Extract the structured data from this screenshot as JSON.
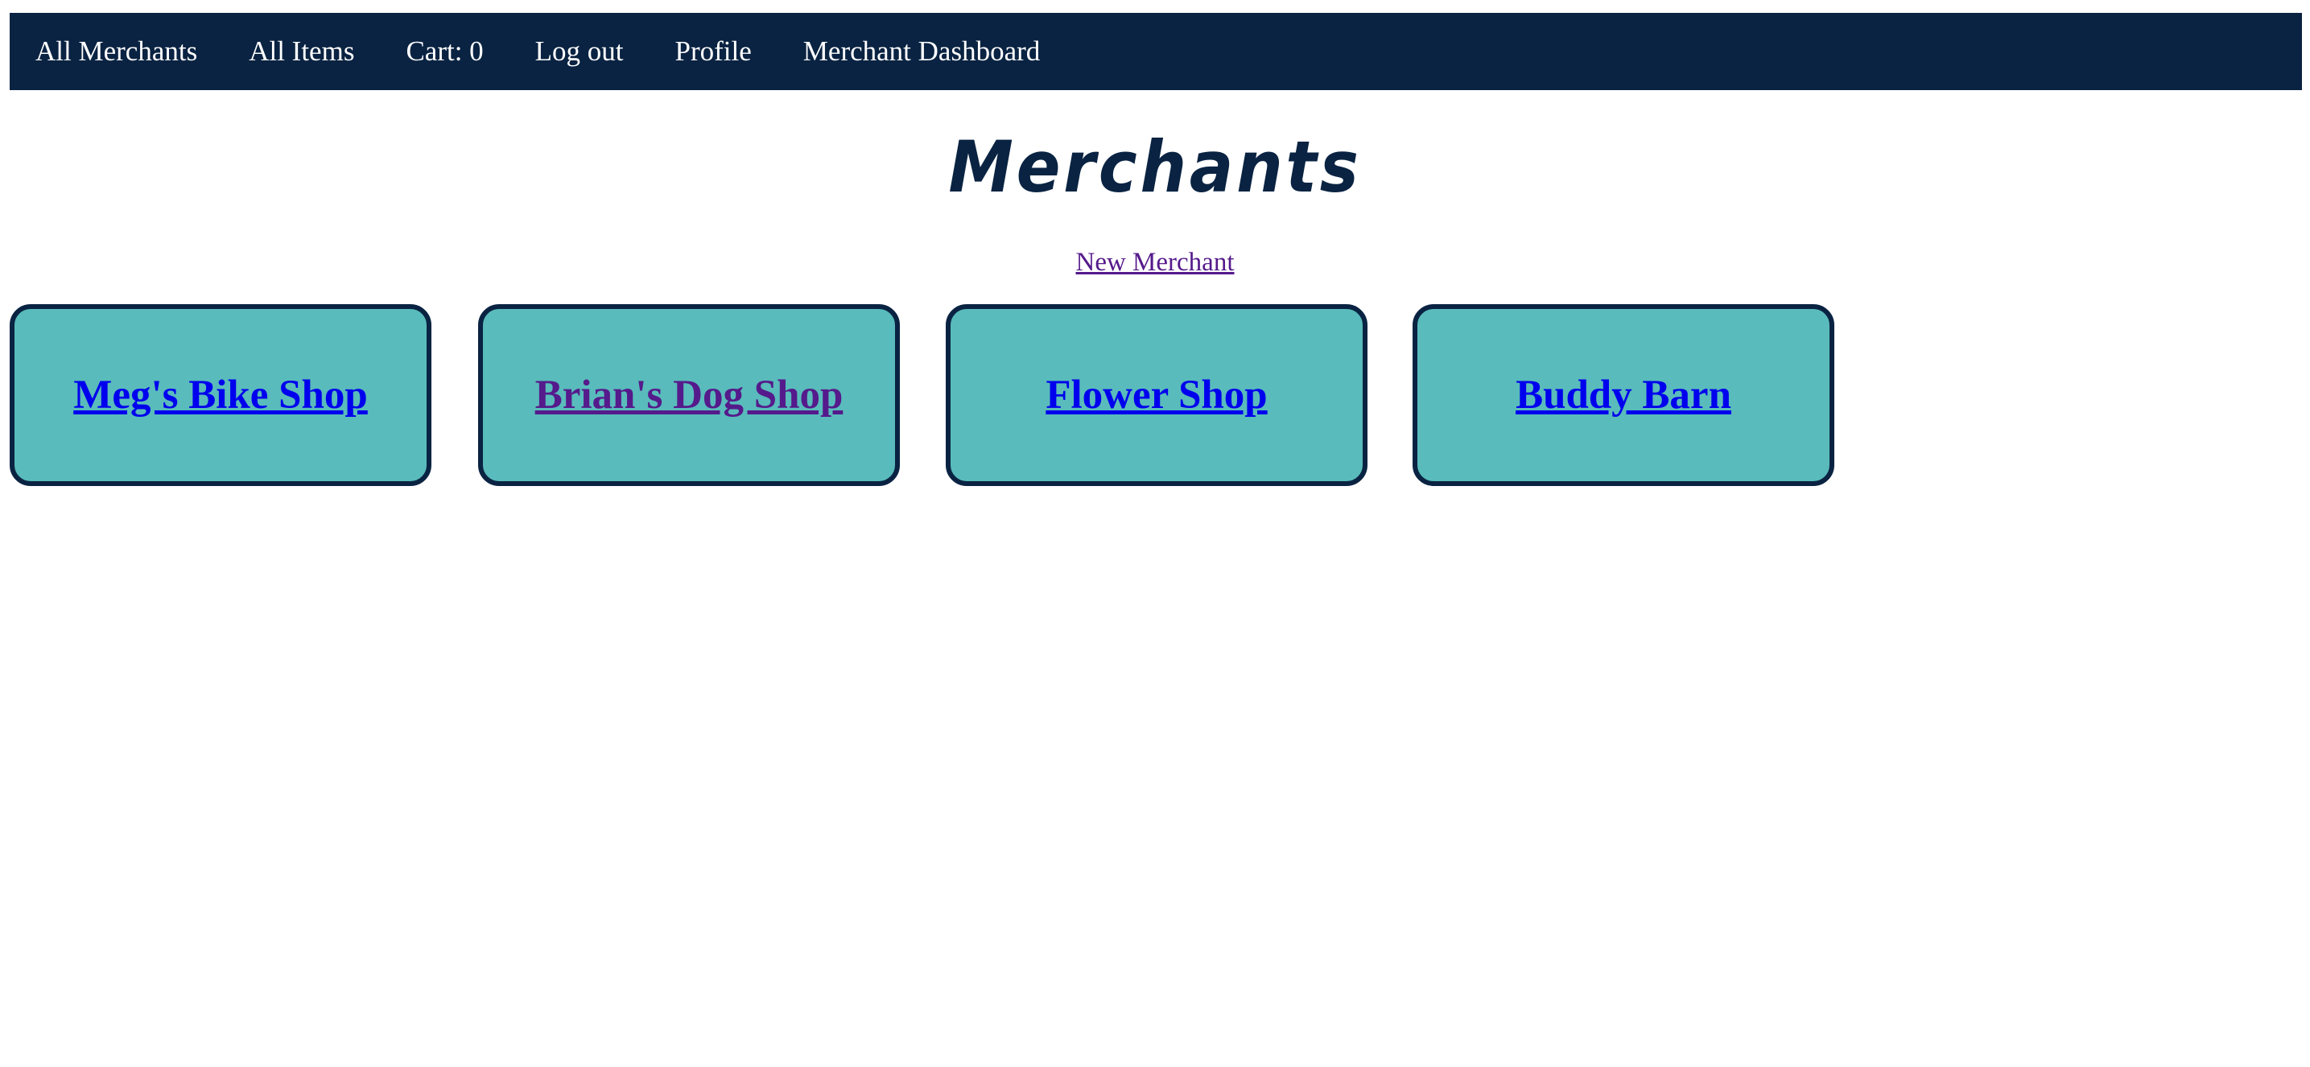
{
  "nav": {
    "items": [
      {
        "label": "All Merchants"
      },
      {
        "label": "All Items"
      },
      {
        "label": "Cart: 0"
      },
      {
        "label": "Log out"
      },
      {
        "label": "Profile"
      },
      {
        "label": "Merchant Dashboard"
      }
    ],
    "background": "#0a2342"
  },
  "main": {
    "title": "Merchants",
    "new_merchant_link": "New Merchant",
    "merchants": [
      {
        "name": "Meg's Bike Shop",
        "visited": false
      },
      {
        "name": "Brian's Dog Shop",
        "visited": true
      },
      {
        "name": "Flower Shop",
        "visited": false
      },
      {
        "name": "Buddy Barn",
        "visited": false
      }
    ]
  },
  "colors": {
    "card_fill": "#59bbbb",
    "card_border": "#0a2342",
    "link": "#0000ee",
    "visited_link": "#551a8b"
  }
}
